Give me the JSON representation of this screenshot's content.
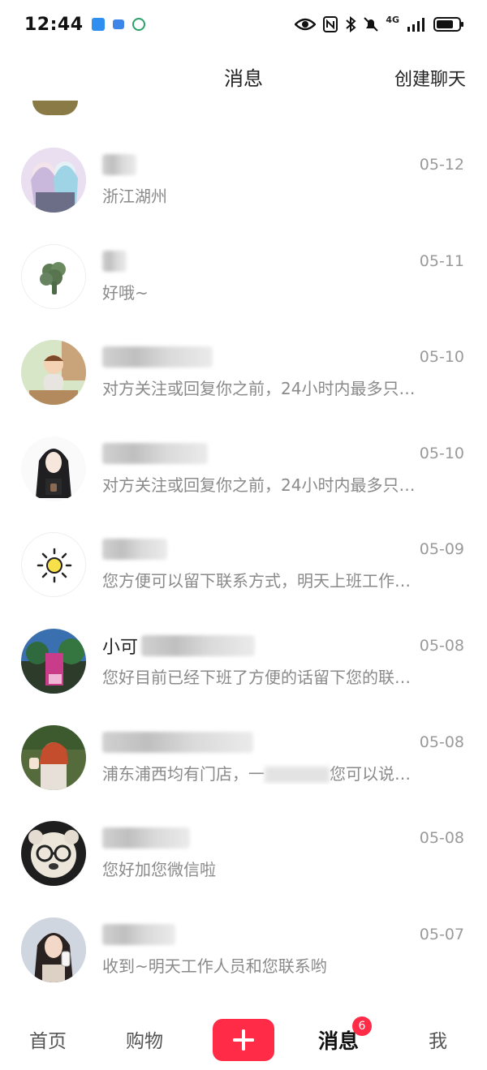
{
  "status_bar": {
    "time": "12:44",
    "network_label": "4G"
  },
  "header": {
    "title": "消息",
    "action": "创建聊天"
  },
  "conversations": [
    {
      "name": "",
      "date": "05-12",
      "preview": "浙江湖州",
      "avatar": "anime-girls-avatar"
    },
    {
      "name": "",
      "date": "05-11",
      "preview": "好哦~",
      "avatar": "broccoli-avatar"
    },
    {
      "name": "",
      "date": "05-10",
      "preview": "对方关注或回复你之前，24小时内最多只…",
      "avatar": "cartoon-girl-avatar"
    },
    {
      "name": "",
      "date": "05-10",
      "preview": "对方关注或回复你之前，24小时内最多只…",
      "avatar": "dark-hair-girl-avatar"
    },
    {
      "name": "",
      "date": "05-09",
      "preview": "您方便可以留下联系方式，明天上班工作…",
      "avatar": "sun-avatar"
    },
    {
      "name": "小可",
      "date": "05-08",
      "preview": "您好目前已经下班了方便的话留下您的联…",
      "avatar": "street-photo-avatar"
    },
    {
      "name": "",
      "date": "05-08",
      "preview": "浦东浦西均有门店，一",
      "avatar": "woman-photo-avatar"
    },
    {
      "name": "",
      "date": "05-08",
      "preview": "您好加您微信啦",
      "avatar": "bear-glasses-avatar"
    },
    {
      "name": "",
      "date": "05-07",
      "preview": "收到~明天工作人员和您联系哟",
      "avatar": "woman-drink-avatar"
    }
  ],
  "preview_tail_7": "您可以说…",
  "tabbar": {
    "home": "首页",
    "shop": "购物",
    "messages": "消息",
    "messages_badge": "6",
    "me": "我"
  },
  "colors": {
    "accent": "#ff2b47",
    "secondary_text": "#8a8a8a",
    "date_text": "#9a9a9a"
  }
}
